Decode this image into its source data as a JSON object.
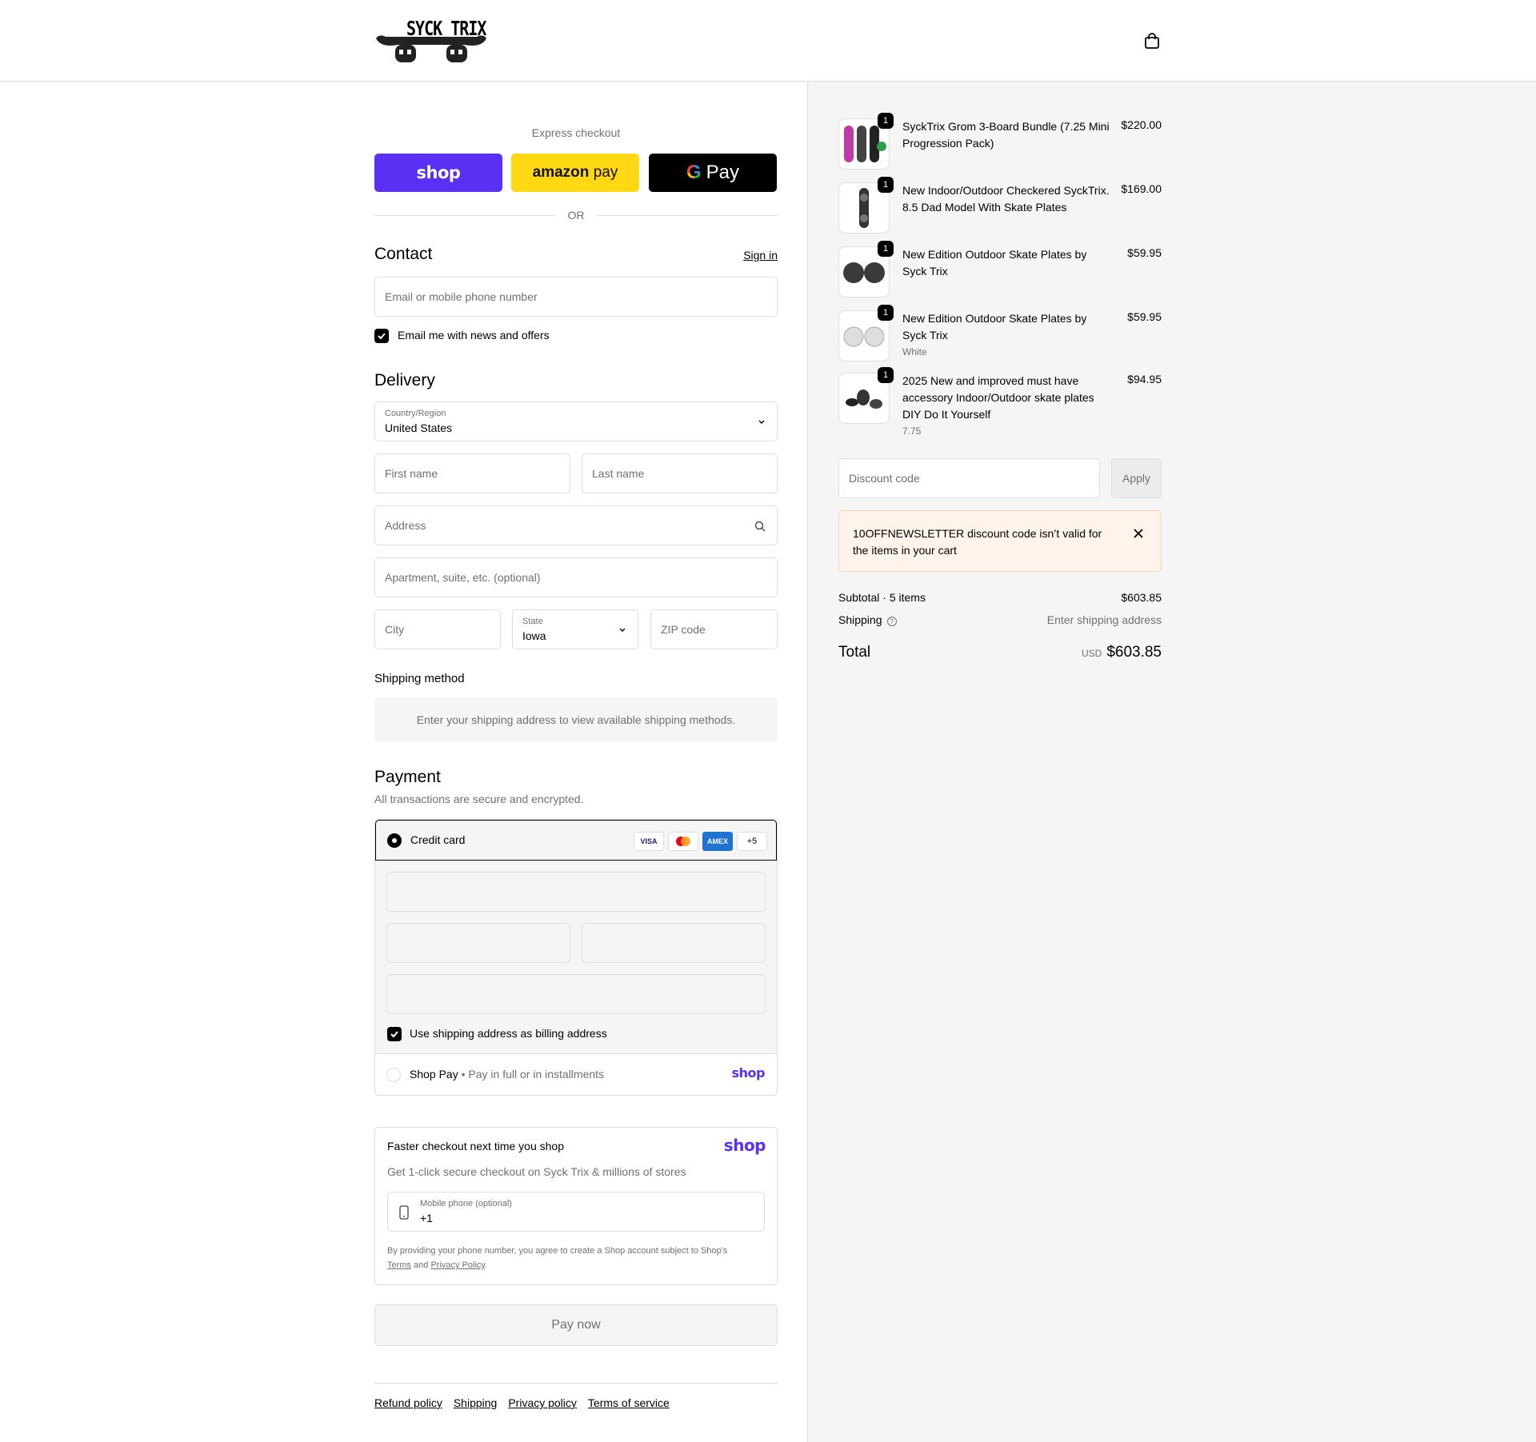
{
  "header": {
    "logo_text": "SYCK TRIX",
    "cart_icon": "shopping-bag-icon"
  },
  "express": {
    "title": "Express checkout",
    "shop_label": "shop",
    "amazon_label_bold": "amazon",
    "amazon_label": "pay",
    "gpay_g": "G",
    "gpay_label": "Pay",
    "or": "OR"
  },
  "contact": {
    "heading": "Contact",
    "sign_in": "Sign in",
    "email_placeholder": "Email or mobile phone number",
    "newsletter_label": "Email me with news and offers",
    "newsletter_checked": true
  },
  "delivery": {
    "heading": "Delivery",
    "country_label": "Country/Region",
    "country_value": "United States",
    "first_name_placeholder": "First name",
    "last_name_placeholder": "Last name",
    "address_placeholder": "Address",
    "apartment_placeholder": "Apartment, suite, etc. (optional)",
    "city_placeholder": "City",
    "state_label": "State",
    "state_value": "Iowa",
    "zip_placeholder": "ZIP code"
  },
  "shipping_method": {
    "title": "Shipping method",
    "message": "Enter your shipping address to view available shipping methods."
  },
  "payment": {
    "heading": "Payment",
    "subtitle": "All transactions are secure and encrypted.",
    "credit_card_label": "Credit card",
    "cards": [
      "VISA",
      "",
      "AMEX",
      "+5"
    ],
    "billing_label": "Use shipping address as billing address",
    "shop_pay_label": "Shop Pay",
    "shop_pay_sub": "Pay in full or in installments",
    "shop_pay_logo": "shop"
  },
  "shop_signup": {
    "title": "Faster checkout next time you shop",
    "subtitle": "Get 1-click secure checkout on Syck Trix & millions of stores",
    "logo": "shop",
    "phone_label": "Mobile phone (optional)",
    "phone_value": "+1",
    "consent_prefix": "By providing your phone number, you agree to create a Shop account subject to Shop's",
    "terms": "Terms",
    "and": "and",
    "privacy": "Privacy Policy",
    "period": "."
  },
  "pay_now": "Pay now",
  "footer": {
    "links": [
      "Refund policy",
      "Shipping",
      "Privacy policy",
      "Terms of service"
    ]
  },
  "cart": {
    "items": [
      {
        "qty": "1",
        "title": "SyckTrix Grom 3-Board Bundle (7.25 Mini Progression Pack)",
        "variant": "",
        "price": "$220.00"
      },
      {
        "qty": "1",
        "title": "New Indoor/Outdoor Checkered SyckTrix. 8.5 Dad Model With Skate Plates",
        "variant": "",
        "price": "$169.00"
      },
      {
        "qty": "1",
        "title": "New Edition Outdoor Skate Plates by Syck Trix",
        "variant": "",
        "price": "$59.95"
      },
      {
        "qty": "1",
        "title": "New Edition Outdoor Skate Plates by Syck Trix",
        "variant": "White",
        "price": "$59.95"
      },
      {
        "qty": "1",
        "title": "2025 New and improved must have accessory Indoor/Outdoor skate plates DIY Do It Yourself",
        "variant": "7.75",
        "price": "$94.95"
      }
    ],
    "discount_placeholder": "Discount code",
    "apply": "Apply",
    "notice": "10OFFNEWSLETTER discount code isn’t valid for the items in your cart",
    "subtotal_label": "Subtotal · 5 items",
    "subtotal_value": "$603.85",
    "shipping_label": "Shipping",
    "shipping_value": "Enter shipping address",
    "total_label": "Total",
    "currency": "USD",
    "total_value": "$603.85"
  },
  "colors": {
    "shop_purple": "#5a31f4",
    "amazon_yellow": "#ffd814",
    "notice_bg": "#fff4ec"
  }
}
